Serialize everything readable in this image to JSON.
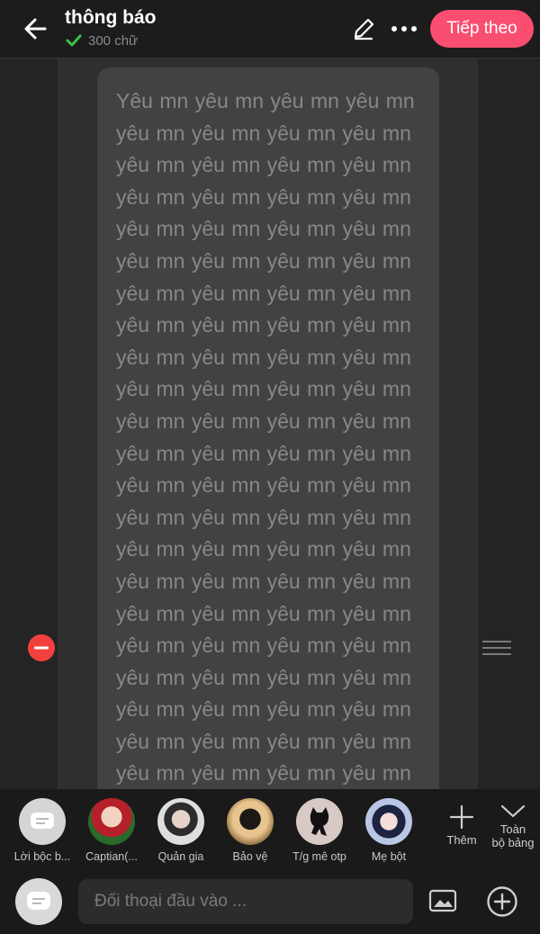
{
  "header": {
    "title": "thông báo",
    "word_count": "300 chữ",
    "next_label": "Tiếp theo"
  },
  "card": {
    "text": "Yêu mn yêu mn yêu mn yêu mn yêu mn yêu mn yêu mn yêu mn yêu mn yêu mn yêu mn yêu mn yêu mn yêu mn yêu mn yêu mn yêu mn yêu mn yêu mn yêu mn yêu mn yêu mn yêu mn yêu mn yêu mn yêu mn yêu mn yêu mn yêu mn yêu mn yêu mn yêu mn yêu mn yêu mn yêu mn yêu mn yêu mn yêu mn yêu mn yêu mn yêu mn yêu mn yêu mn yêu mn yêu mn yêu mn yêu mn yêu mn yêu mn yêu mn yêu mn yêu mn yêu mn yêu mn yêu mn yêu mn yêu mn yêu mn yêu mn yêu mn yêu mn yêu mn yêu mn yêu mn yêu mn yêu mn yêu mn yêu mn yêu mn yêu mn yêu mn yêu mn yêu mn yêu mn yêu mn yêu mn yêu mn yêu mn yêu mn yêu mn yêu mn yêu mn yêu mn yêu mn yêu mn yêu mn yêu mn yêu mn"
  },
  "characters": [
    {
      "label": "Lời bộc b..."
    },
    {
      "label": "Captian(..."
    },
    {
      "label": "Quản gia"
    },
    {
      "label": "Bảo vệ"
    },
    {
      "label": "T/g mê otp"
    },
    {
      "label": "Mẹ bột"
    }
  ],
  "tools": {
    "more_label": "Thêm",
    "all_label_1": "Toàn",
    "all_label_2": "bộ bảng"
  },
  "input": {
    "placeholder": "Đối thoại đầu vào ..."
  },
  "colors": {
    "accent": "#fa4e71",
    "check": "#3fbf4a",
    "delete": "#f2413c"
  }
}
